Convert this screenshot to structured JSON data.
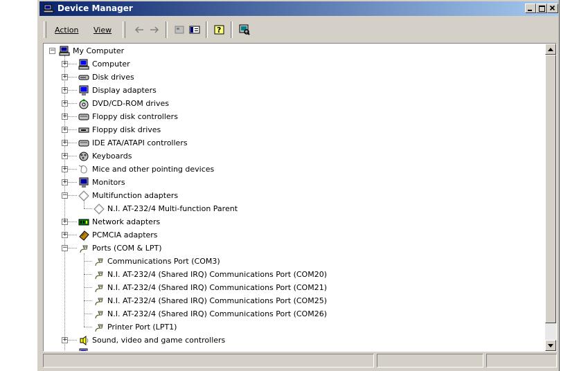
{
  "window": {
    "title": "Device Manager"
  },
  "menu": {
    "action": "Action",
    "view": "View"
  },
  "toolbar": {
    "back_icon": "back-arrow-icon",
    "forward_icon": "forward-arrow-icon",
    "properties_icon": "properties-icon",
    "show_hide_icon": "show-hide-tree-icon",
    "help_icon": "help-icon",
    "scan_icon": "scan-hardware-icon"
  },
  "tree": {
    "root": "My Computer",
    "items": [
      {
        "label": "Computer",
        "icon": "computer-icon",
        "expanded": false
      },
      {
        "label": "Disk drives",
        "icon": "disk-drive-icon",
        "expanded": false
      },
      {
        "label": "Display adapters",
        "icon": "display-adapter-icon",
        "expanded": false
      },
      {
        "label": "DVD/CD-ROM drives",
        "icon": "cdrom-icon",
        "expanded": false
      },
      {
        "label": "Floppy disk controllers",
        "icon": "controller-icon",
        "expanded": false
      },
      {
        "label": "Floppy disk drives",
        "icon": "floppy-icon",
        "expanded": false
      },
      {
        "label": "IDE ATA/ATAPI controllers",
        "icon": "controller-icon",
        "expanded": false
      },
      {
        "label": "Keyboards",
        "icon": "keyboard-icon",
        "expanded": false
      },
      {
        "label": "Mice and other pointing devices",
        "icon": "mouse-icon",
        "expanded": false
      },
      {
        "label": "Monitors",
        "icon": "monitor-icon",
        "expanded": false
      },
      {
        "label": "Multifunction adapters",
        "icon": "multifunction-icon",
        "expanded": true,
        "children": [
          "N.I. AT-232/4 Multi-function Parent"
        ]
      },
      {
        "label": "Network adapters",
        "icon": "network-icon",
        "expanded": false
      },
      {
        "label": "PCMCIA adapters",
        "icon": "pcmcia-icon",
        "expanded": false
      },
      {
        "label": "Ports (COM & LPT)",
        "icon": "port-icon",
        "expanded": true,
        "children": [
          "Communications Port (COM3)",
          "N.I. AT-232/4 (Shared IRQ) Communications Port (COM20)",
          "N.I. AT-232/4 (Shared IRQ) Communications Port (COM21)",
          "N.I. AT-232/4 (Shared IRQ) Communications Port (COM25)",
          "N.I. AT-232/4 (Shared IRQ) Communications Port (COM26)",
          "Printer Port (LPT1)"
        ]
      },
      {
        "label": "Sound, video and game controllers",
        "icon": "sound-icon",
        "expanded": false
      }
    ]
  },
  "colors": {
    "titlebar_start": "#0a246a",
    "titlebar_end": "#a6caf0",
    "face": "#d4d0c8"
  }
}
